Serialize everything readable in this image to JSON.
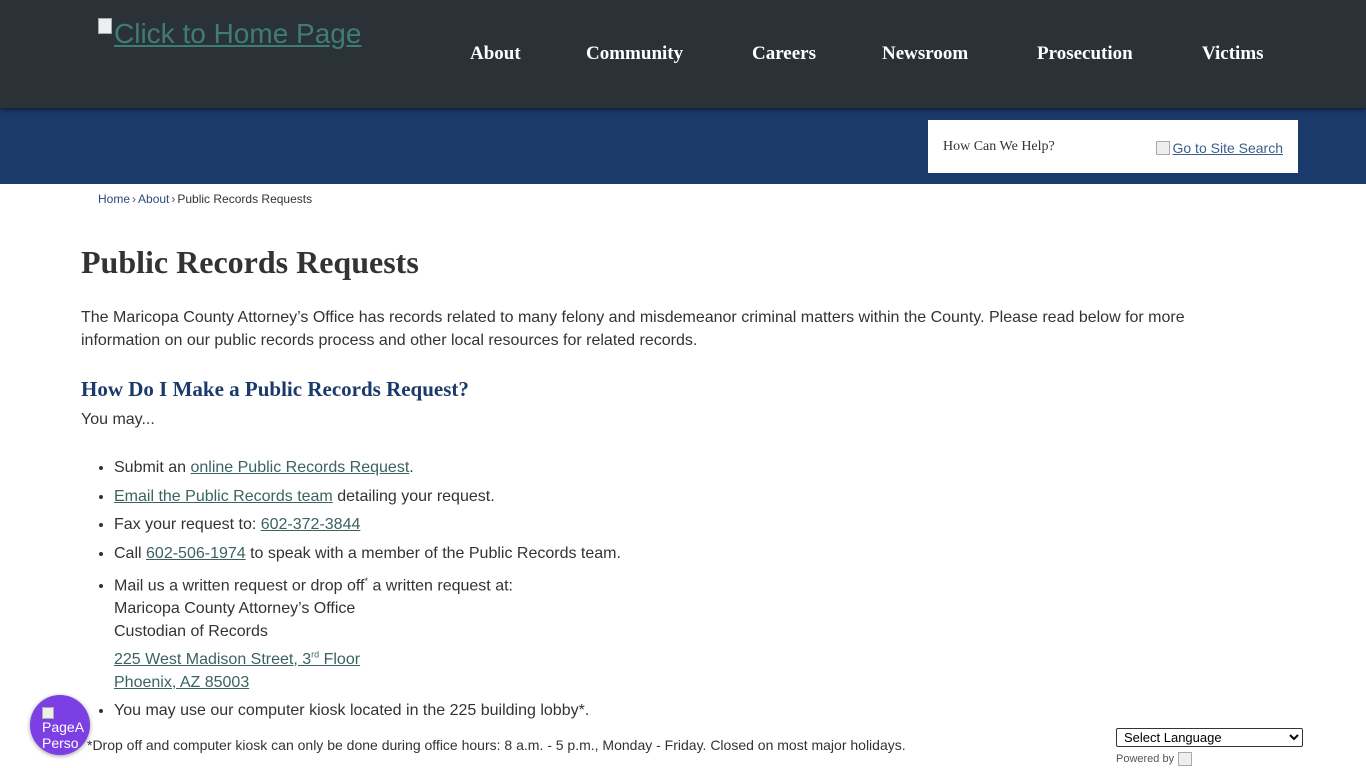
{
  "header": {
    "logo_alt": "Click to Home Page",
    "nav": [
      {
        "label": "About"
      },
      {
        "label": "Community"
      },
      {
        "label": "Careers"
      },
      {
        "label": "Newsroom"
      },
      {
        "label": "Prosecution"
      },
      {
        "label": "Victims"
      }
    ]
  },
  "search": {
    "placeholder": "How Can We Help?",
    "button_alt": "Go to Site Search"
  },
  "breadcrumb": {
    "items": [
      "Home",
      "About"
    ],
    "current": "Public Records Requests",
    "separator": "›"
  },
  "page": {
    "title": "Public Records Requests",
    "intro": "The Maricopa County Attorney’s Office has records related to many felony and misdemeanor criminal matters within the County. Please read below for more information on our public records process and other local resources for related records.",
    "section_title": "How Do I Make a Public Records Request?",
    "you_may": "You may...",
    "steps": {
      "s1_pre": "Submit an ",
      "s1_link": "online Public Records Request",
      "s1_post": ".",
      "s2_link": "Email the Public Records team",
      "s2_post": " detailing your request.",
      "s3_pre": "Fax your request to: ",
      "s3_link": "602-372-3844",
      "s4_pre": "Call ",
      "s4_link": "602-506-1974",
      "s4_post": " to speak with a member of the Public Records team.",
      "s5_pre": "Mail us a written request or drop off",
      "s5_sup": "*",
      "s5_post": " a written request at:",
      "s5_line1": "Maricopa County Attorney’s Office",
      "s5_line2": "Custodian of Records",
      "s5_addr1": "225 West Madison Street, 3",
      "s5_addr1_sup": "rd",
      "s5_addr1_post": " Floor",
      "s5_addr2": "Phoenix, AZ 85003",
      "s6": "You may use our computer kiosk located in the 225 building lobby*."
    },
    "note": "*Drop off and computer kiosk can only be done during office hours: 8 a.m. - 5 p.m., Monday - Friday. Closed on most major holidays."
  },
  "widget": {
    "text": "PageA\nPerso"
  },
  "translate": {
    "selected": "Select Language",
    "powered_by": "Powered by"
  },
  "colors": {
    "topbar": "#2b3237",
    "bluebar": "#1b3a6c",
    "link": "#3a6360",
    "fab": "#7b3fe4"
  }
}
